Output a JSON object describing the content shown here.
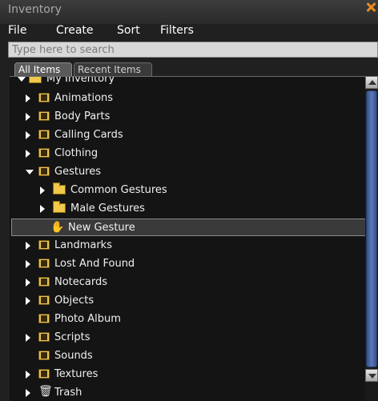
{
  "window": {
    "title": "Inventory"
  },
  "menu": {
    "file": "File",
    "create": "Create",
    "sort": "Sort",
    "filters": "Filters"
  },
  "search": {
    "placeholder": "Type here to search"
  },
  "tabs": {
    "all": "All Items",
    "recent": "Recent Items"
  },
  "tree": {
    "root": "My Inventory",
    "items": [
      {
        "label": "Animations",
        "icon": "animation-icon"
      },
      {
        "label": "Body Parts",
        "icon": "bodyparts-icon"
      },
      {
        "label": "Calling Cards",
        "icon": "callingcard-icon"
      },
      {
        "label": "Clothing",
        "icon": "clothing-icon"
      },
      {
        "label": "Gestures",
        "icon": "gesture-icon"
      },
      {
        "label": "Common Gestures",
        "icon": "folder-icon"
      },
      {
        "label": "Male Gestures",
        "icon": "folder-icon"
      },
      {
        "label": "New Gesture",
        "icon": "gesture-hand-icon"
      },
      {
        "label": "Landmarks",
        "icon": "landmark-icon"
      },
      {
        "label": "Lost And Found",
        "icon": "lostandfound-icon"
      },
      {
        "label": "Notecards",
        "icon": "notecard-icon"
      },
      {
        "label": "Objects",
        "icon": "object-icon"
      },
      {
        "label": "Photo Album",
        "icon": "photoalbum-icon"
      },
      {
        "label": "Scripts",
        "icon": "script-icon"
      },
      {
        "label": "Sounds",
        "icon": "sound-icon"
      },
      {
        "label": "Textures",
        "icon": "texture-icon"
      },
      {
        "label": "Trash",
        "icon": "trash-icon"
      }
    ]
  }
}
